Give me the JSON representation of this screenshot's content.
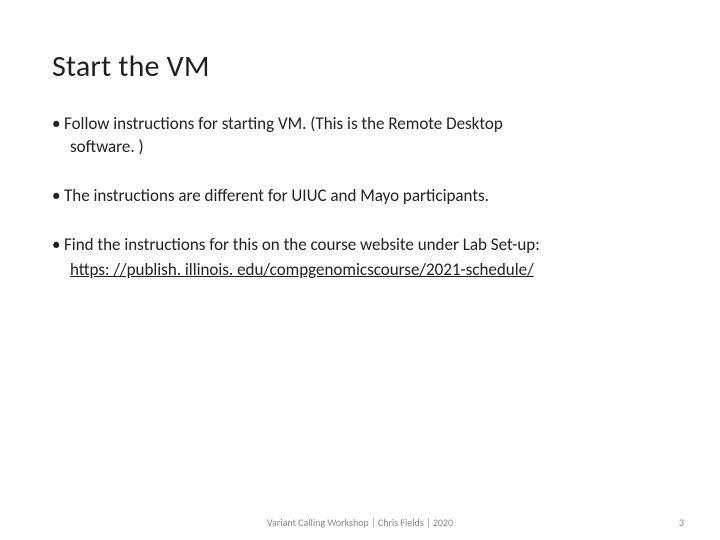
{
  "title": "Start the VM",
  "bullets": [
    {
      "line1": "Follow instructions for starting VM. (This is the Remote Desktop",
      "line2": "software. )"
    },
    {
      "line1": "The instructions are different for UIUC and Mayo participants."
    },
    {
      "line1": "Find the instructions for this on the course website under Lab Set-up:",
      "link": "https: //publish. illinois. edu/compgenomicscourse/2021-schedule/"
    }
  ],
  "footer": {
    "center": "Variant Calling Workshop | Chris Fields | 2020",
    "page": "3"
  }
}
